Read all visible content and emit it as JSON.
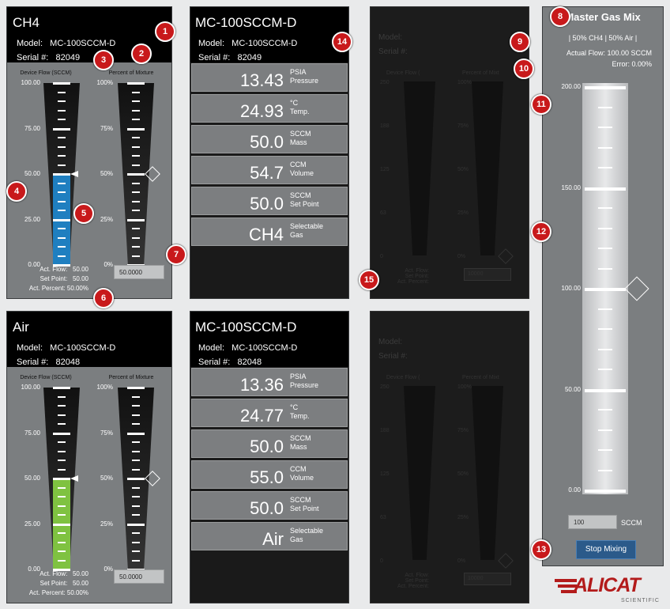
{
  "devices": [
    {
      "name": "CH4",
      "model": "Model:   MC-100SCCM-D",
      "serial": "Serial #:   82049",
      "flow_title": "Device Flow (SCCM)",
      "pct_title": "Percent of Mixture",
      "flow_axis": [
        "100.00",
        "75.00",
        "50.00",
        "25.00",
        "0.00"
      ],
      "pct_axis": [
        "100%",
        "75%",
        "50%",
        "25%",
        "0%"
      ],
      "flow_fraction": 0.5,
      "fill_color": "#1f7fc0",
      "pct_input": "50.0000",
      "act_flow": "Act. Flow:   50.00",
      "set_point": "Set Point:   50.00",
      "act_percent": "Act. Percent: 50.00%"
    },
    {
      "name": "Air",
      "model": "Model:   MC-100SCCM-D",
      "serial": "Serial #:   82048",
      "flow_title": "Device Flow (SCCM)",
      "pct_title": "Percent of Mixture",
      "flow_axis": [
        "100.00",
        "75.00",
        "50.00",
        "25.00",
        "0.00"
      ],
      "pct_axis": [
        "100%",
        "75%",
        "50%",
        "25%",
        "0%"
      ],
      "flow_fraction": 0.5,
      "fill_color": "#7fc241",
      "pct_input": "50.0000",
      "act_flow": "Act. Flow:   50.00",
      "set_point": "Set Point:   50.00",
      "act_percent": "Act. Percent: 50.00%"
    }
  ],
  "readouts": [
    {
      "title": "MC-100SCCM-D",
      "model": "Model:   MC-100SCCM-D",
      "serial": "Serial #:   82049",
      "rows": [
        {
          "value": "13.43",
          "unit": "PSIA\nPressure"
        },
        {
          "value": "24.93",
          "unit": "°C\nTemp."
        },
        {
          "value": "50.0",
          "unit": "SCCM\nMass"
        },
        {
          "value": "54.7",
          "unit": "CCM\nVolume"
        },
        {
          "value": "50.0",
          "unit": "SCCM\nSet Point"
        },
        {
          "value": "CH4",
          "unit": "Selectable\nGas"
        }
      ]
    },
    {
      "title": "MC-100SCCM-D",
      "model": "Model:   MC-100SCCM-D",
      "serial": "Serial #:   82048",
      "rows": [
        {
          "value": "13.36",
          "unit": "PSIA\nPressure"
        },
        {
          "value": "24.77",
          "unit": "°C\nTemp."
        },
        {
          "value": "50.0",
          "unit": "SCCM\nMass"
        },
        {
          "value": "55.0",
          "unit": "CCM\nVolume"
        },
        {
          "value": "50.0",
          "unit": "SCCM\nSet Point"
        },
        {
          "value": "Air",
          "unit": "Selectable\nGas"
        }
      ]
    }
  ],
  "ghost": {
    "model": "Model:",
    "serial": "Serial #:",
    "flow_title": "Device Flow (",
    "pct_title": "Percent of Mixt",
    "flow_axis": [
      "250",
      "188",
      "125",
      "63",
      "0"
    ],
    "pct_axis": [
      "100%",
      "75%",
      "50%",
      "25%",
      "0%"
    ],
    "stats": "Act. Flow:\nSet Point:\nAct. Percent:",
    "pct_input": "10000"
  },
  "master": {
    "title": "Master Gas Mix",
    "mix": "| 50% CH4 |   50% Air |",
    "actual_flow": "Actual Flow: 100.00 SCCM",
    "error": "Error: 0.00%",
    "axis": [
      "200.00",
      "150.00",
      "100.00",
      "50.00",
      "0.00"
    ],
    "setpoint_value": "100",
    "unit": "SCCM",
    "button": "Stop Mixing",
    "setpoint_fraction": 0.5
  },
  "callouts": [
    "1",
    "2",
    "3",
    "4",
    "5",
    "6",
    "7",
    "8",
    "9",
    "10",
    "11",
    "12",
    "13",
    "14",
    "15"
  ],
  "logo": {
    "text": "ALICAT",
    "sub": "SCIENTIFIC"
  }
}
